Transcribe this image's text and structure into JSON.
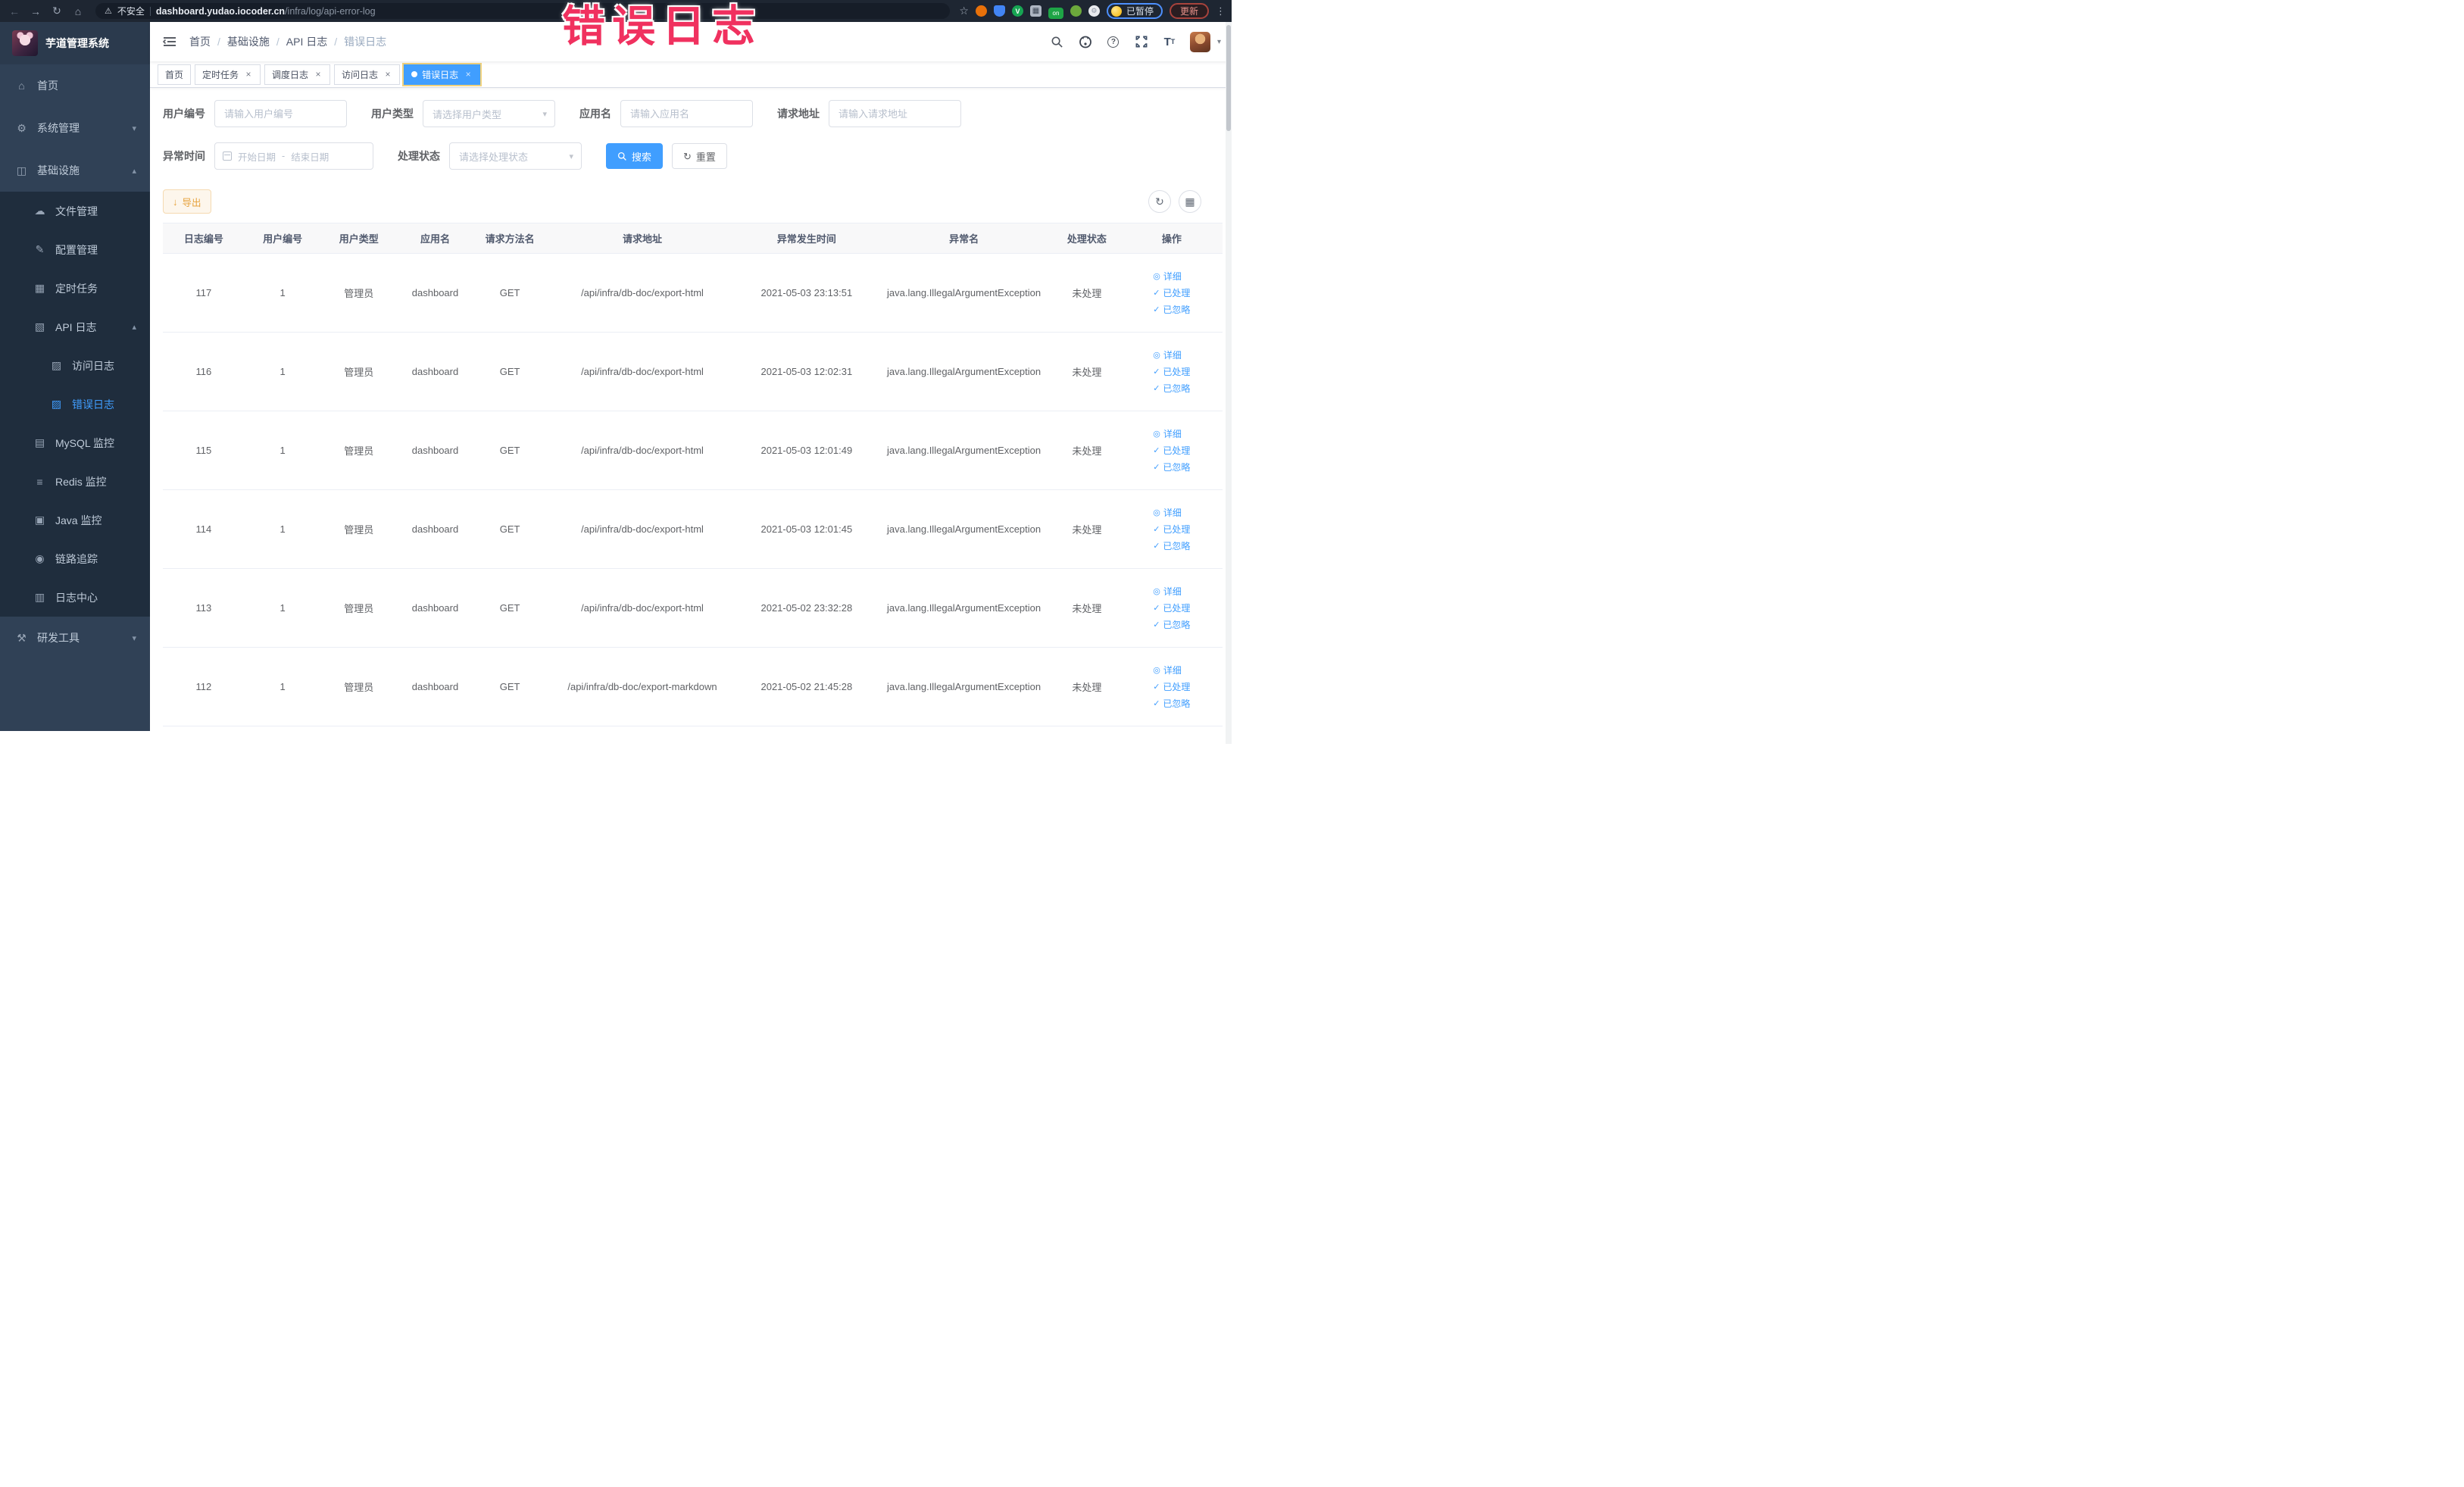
{
  "annotation": {
    "text": "错误日志"
  },
  "colors": {
    "accent": "#409eff",
    "warning": "#e6a23c",
    "annotation": "#f0315f",
    "sidebar_bg": "#304156",
    "submenu_bg": "#1f2d3d"
  },
  "browser": {
    "security_label": "不安全",
    "url_host": "dashboard.yudao.iocoder.cn",
    "url_path": "/infra/log/api-error-log",
    "paused_badge": "已暂停",
    "update_label": "更新"
  },
  "sidebar": {
    "logo_title": "芋道管理系统",
    "items": [
      {
        "label": "首页",
        "icon": "home",
        "level": 0
      },
      {
        "label": "系统管理",
        "icon": "gear",
        "level": 0,
        "arrow": "down"
      },
      {
        "label": "基础设施",
        "icon": "infrastructure",
        "level": 0,
        "arrow": "up"
      },
      {
        "label": "文件管理",
        "icon": "cloud-upload",
        "level": 1
      },
      {
        "label": "配置管理",
        "icon": "edit",
        "level": 1
      },
      {
        "label": "定时任务",
        "icon": "schedule",
        "level": 1
      },
      {
        "label": "API 日志",
        "icon": "api-log",
        "level": 1,
        "arrow": "up"
      },
      {
        "label": "访问日志",
        "icon": "access-log",
        "level": 2
      },
      {
        "label": "错误日志",
        "icon": "error-log",
        "level": 2,
        "active": true
      },
      {
        "label": "MySQL 监控",
        "icon": "mysql-monitor",
        "level": 1
      },
      {
        "label": "Redis 监控",
        "icon": "redis-monitor",
        "level": 1
      },
      {
        "label": "Java 监控",
        "icon": "java-monitor",
        "level": 1
      },
      {
        "label": "链路追踪",
        "icon": "trace",
        "level": 1
      },
      {
        "label": "日志中心",
        "icon": "log-center",
        "level": 1
      },
      {
        "label": "研发工具",
        "icon": "dev-tools",
        "level": 0,
        "arrow": "down"
      }
    ]
  },
  "breadcrumb": {
    "items": [
      "首页",
      "基础设施",
      "API 日志",
      "错误日志"
    ]
  },
  "tabs": {
    "items": [
      {
        "label": "首页",
        "closable": false,
        "active": false
      },
      {
        "label": "定时任务",
        "closable": true,
        "active": false
      },
      {
        "label": "调度日志",
        "closable": true,
        "active": false
      },
      {
        "label": "访问日志",
        "closable": true,
        "active": false
      },
      {
        "label": "错误日志",
        "closable": true,
        "active": true
      }
    ]
  },
  "filters": {
    "user_id": {
      "label": "用户编号",
      "placeholder": "请输入用户编号"
    },
    "user_type": {
      "label": "用户类型",
      "placeholder": "请选择用户类型"
    },
    "app_name": {
      "label": "应用名",
      "placeholder": "请输入应用名"
    },
    "request_url": {
      "label": "请求地址",
      "placeholder": "请输入请求地址"
    },
    "exception_time": {
      "label": "异常时间",
      "start_placeholder": "开始日期",
      "separator": "-",
      "end_placeholder": "结束日期"
    },
    "process_status": {
      "label": "处理状态",
      "placeholder": "请选择处理状态"
    },
    "search_label": "搜索",
    "reset_label": "重置"
  },
  "toolbar": {
    "export_label": "导出"
  },
  "table": {
    "headers": [
      "日志编号",
      "用户编号",
      "用户类型",
      "应用名",
      "请求方法名",
      "请求地址",
      "异常发生时间",
      "异常名",
      "处理状态",
      "操作"
    ],
    "row_actions": [
      {
        "label": "详细",
        "icon": "eye",
        "name": "detail"
      },
      {
        "label": "已处理",
        "icon": "check",
        "name": "mark-processed"
      },
      {
        "label": "已忽略",
        "icon": "check",
        "name": "mark-ignored"
      }
    ],
    "rows": [
      {
        "log_id": "117",
        "user_id": "1",
        "user_type": "管理员",
        "app_name": "dashboard",
        "method": "GET",
        "url": "/api/infra/db-doc/export-html",
        "time": "2021-05-03 23:13:51",
        "exception": "java.lang.IllegalArgumentException",
        "status": "未处理"
      },
      {
        "log_id": "116",
        "user_id": "1",
        "user_type": "管理员",
        "app_name": "dashboard",
        "method": "GET",
        "url": "/api/infra/db-doc/export-html",
        "time": "2021-05-03 12:02:31",
        "exception": "java.lang.IllegalArgumentException",
        "status": "未处理"
      },
      {
        "log_id": "115",
        "user_id": "1",
        "user_type": "管理员",
        "app_name": "dashboard",
        "method": "GET",
        "url": "/api/infra/db-doc/export-html",
        "time": "2021-05-03 12:01:49",
        "exception": "java.lang.IllegalArgumentException",
        "status": "未处理"
      },
      {
        "log_id": "114",
        "user_id": "1",
        "user_type": "管理员",
        "app_name": "dashboard",
        "method": "GET",
        "url": "/api/infra/db-doc/export-html",
        "time": "2021-05-03 12:01:45",
        "exception": "java.lang.IllegalArgumentException",
        "status": "未处理"
      },
      {
        "log_id": "113",
        "user_id": "1",
        "user_type": "管理员",
        "app_name": "dashboard",
        "method": "GET",
        "url": "/api/infra/db-doc/export-html",
        "time": "2021-05-02 23:32:28",
        "exception": "java.lang.IllegalArgumentException",
        "status": "未处理"
      },
      {
        "log_id": "112",
        "user_id": "1",
        "user_type": "管理员",
        "app_name": "dashboard",
        "method": "GET",
        "url": "/api/infra/db-doc/export-markdown",
        "time": "2021-05-02 21:45:28",
        "exception": "java.lang.IllegalArgumentException",
        "status": "未处理"
      }
    ]
  }
}
